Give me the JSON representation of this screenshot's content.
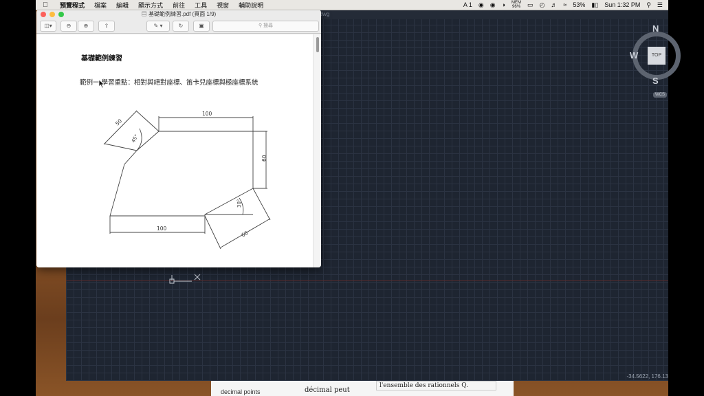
{
  "menubar": {
    "app_name": "預覽程式",
    "items": [
      "檔案",
      "編輯",
      "顯示方式",
      "前往",
      "工具",
      "視窗",
      "輔助說明"
    ],
    "status": {
      "adobe": "A 1",
      "mem_label": "MEM",
      "mem_value": "96%",
      "battery": "53%",
      "clock": "Sun 1:32 PM"
    }
  },
  "cad": {
    "title": "Drawing1.dwg",
    "compass": {
      "n": "N",
      "s": "S",
      "w": "W",
      "top": "TOP",
      "wcs": "WCS"
    },
    "coords": "-34.5622, 176.13"
  },
  "preview": {
    "title": "基礎範例練習.pdf (頁面 1/9)",
    "search_placeholder": "搜尋",
    "page_title": "基礎範例練習",
    "body_text": "範例一  學習重點：相對與絕對座標、笛卡兒座標與極座標系統",
    "dims": {
      "top": "100",
      "bottom": "100",
      "left_top": "50",
      "angle_45": "45°",
      "right": "60",
      "angle_30": "30°",
      "bottom_right": "60"
    }
  },
  "background_doc": {
    "col1": "decimal points",
    "col2": "décimal peut",
    "col3": "l'ensemble des rationnels Q."
  }
}
